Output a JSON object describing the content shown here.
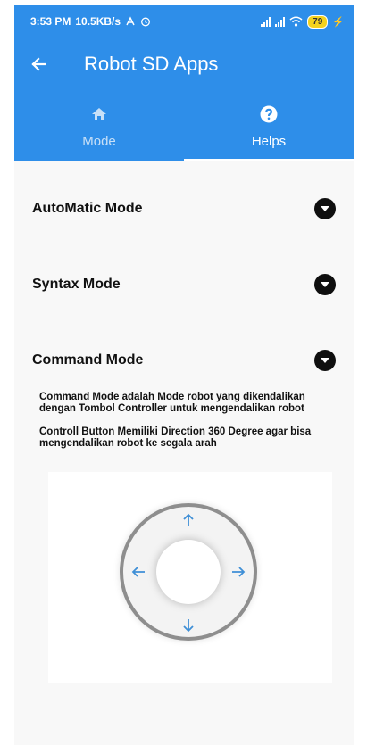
{
  "status_bar": {
    "time": "3:53 PM",
    "network_speed": "10.5KB/s",
    "battery": "79",
    "icons": [
      "usb-debug-icon",
      "alarm-icon",
      "signal-icon",
      "signal-icon",
      "wifi-icon",
      "battery-icon",
      "charging-icon"
    ]
  },
  "app_bar": {
    "title": "Robot SD Apps",
    "back_icon": "arrow-left-icon",
    "color": "#2e8ee9"
  },
  "tabs": [
    {
      "label": "Mode",
      "icon": "home-icon",
      "active": false
    },
    {
      "label": "Helps",
      "icon": "help-circle-icon",
      "active": true
    }
  ],
  "panels": [
    {
      "title": "AutoMatic Mode",
      "expanded": false
    },
    {
      "title": "Syntax Mode",
      "expanded": false
    },
    {
      "title": "Command Mode",
      "expanded": true
    }
  ],
  "command_mode": {
    "description_1": "Command Mode adalah Mode robot yang dikendalikan dengan Tombol Controller untuk mengendalikan robot",
    "description_2": "Controll Button Memiliki Direction 360 Degree agar bisa mengendalikan robot ke segala arah",
    "joystick_icons": [
      "arrow-up-icon",
      "arrow-left-icon",
      "arrow-right-icon",
      "arrow-down-icon"
    ],
    "arrow_color": "#3f8fd6"
  }
}
